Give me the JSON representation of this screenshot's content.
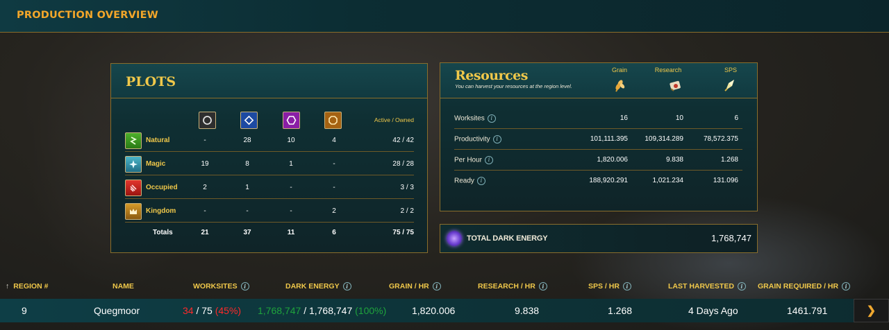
{
  "header": {
    "title": "PRODUCTION OVERVIEW"
  },
  "plots": {
    "title": "PLOTS",
    "active_owned_header": "Active / Owned",
    "column_icons": [
      "natural-icon",
      "magic-icon",
      "occupied-icon",
      "kingdom-icon"
    ],
    "rows": [
      {
        "label": "Natural",
        "c1": "-",
        "c2": "28",
        "c3": "10",
        "c4": "4",
        "ao": "42 / 42"
      },
      {
        "label": "Magic",
        "c1": "19",
        "c2": "8",
        "c3": "1",
        "c4": "-",
        "ao": "28 / 28"
      },
      {
        "label": "Occupied",
        "c1": "2",
        "c2": "1",
        "c3": "-",
        "c4": "-",
        "ao": "3 / 3"
      },
      {
        "label": "Kingdom",
        "c1": "-",
        "c2": "-",
        "c3": "-",
        "c4": "2",
        "ao": "2 / 2"
      }
    ],
    "totals": {
      "label": "Totals",
      "c1": "21",
      "c2": "37",
      "c3": "11",
      "c4": "6",
      "ao": "75 / 75"
    }
  },
  "resources": {
    "title": "Resources",
    "subtitle": "You can harvest your resources at the region level.",
    "columns": [
      "Grain",
      "Research",
      "SPS"
    ],
    "rows": [
      {
        "label": "Worksites",
        "v1": "16",
        "v2": "10",
        "v3": "6"
      },
      {
        "label": "Productivity",
        "v1": "101,111.395",
        "v2": "109,314.289",
        "v3": "78,572.375"
      },
      {
        "label": "Per Hour",
        "v1": "1,820.006",
        "v2": "9.838",
        "v3": "1.268"
      },
      {
        "label": "Ready",
        "v1": "188,920.291",
        "v2": "1,021.234",
        "v3": "131.096"
      }
    ]
  },
  "dark_energy": {
    "label": "TOTAL DARK ENERGY",
    "value": "1,768,747"
  },
  "table": {
    "headers": {
      "region": "REGION #",
      "name": "NAME",
      "worksites": "WORKSITES",
      "dark_energy": "DARK ENERGY",
      "grain_hr": "GRAIN / HR",
      "research_hr": "RESEARCH / HR",
      "sps_hr": "SPS / HR",
      "last_harvested": "LAST HARVESTED",
      "grain_required": "GRAIN REQUIRED / HR"
    },
    "sort_indicator": "↑",
    "row": {
      "region": "9",
      "name": "Quegmoor",
      "worksites_active": "34",
      "worksites_total": "/ 75",
      "worksites_pct": "(45%)",
      "de_current": "1,768,747",
      "de_total": "/ 1,768,747",
      "de_pct": "(100%)",
      "grain_hr": "1,820.006",
      "research_hr": "9.838",
      "sps_hr": "1.268",
      "last_harvested": "4 Days Ago",
      "grain_required": "1461.791"
    }
  },
  "colors": {
    "accent_gold": "#f0c84a",
    "header_orange": "#f2a62a",
    "panel_teal": "#123c42",
    "border_gold": "#8a6e2c",
    "negative_red": "#ff2a2a",
    "positive_green": "#1fa33c"
  }
}
